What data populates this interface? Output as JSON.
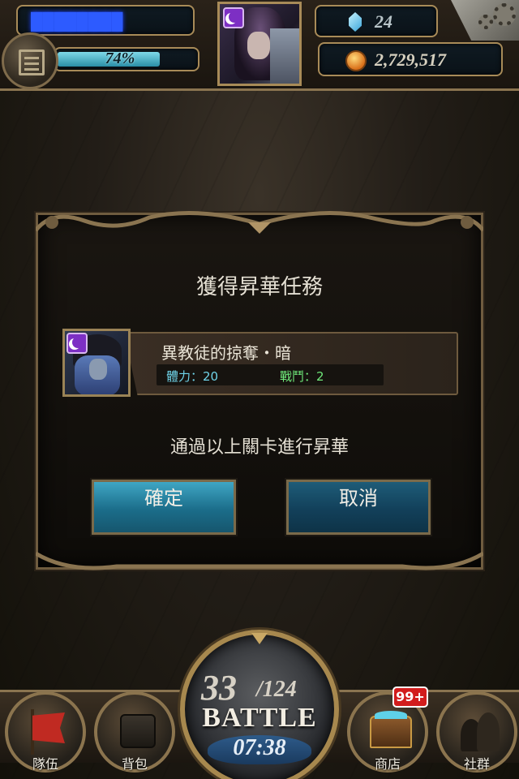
{
  "hud": {
    "player_name": "████████",
    "exp_percent": "74%",
    "exp_fraction": 0.74,
    "gems": "24",
    "coins": "2,729,517"
  },
  "dialog": {
    "title": "獲得昇華任務",
    "stage_name": "異教徒的掠奪・暗",
    "stamina_cost": "體力：20",
    "battles": "戰鬥：2",
    "confirm_text": "通過以上關卡進行昇華",
    "ok_label": "確定",
    "cancel_label": "取消"
  },
  "nav": {
    "team_label": "隊伍",
    "bag_label": "背包",
    "shop_label": "商店",
    "social_label": "社群",
    "shop_badge": "99+",
    "stamina_current": "33",
    "stamina_max": "/124",
    "battle_label": "BATTLE",
    "timer": "07:38"
  },
  "colors": {
    "accent_gold": "#a88b58",
    "stamina_color": "#6fd3e8",
    "battle_color": "#6fe87a",
    "badge_red": "#d21c1c"
  }
}
